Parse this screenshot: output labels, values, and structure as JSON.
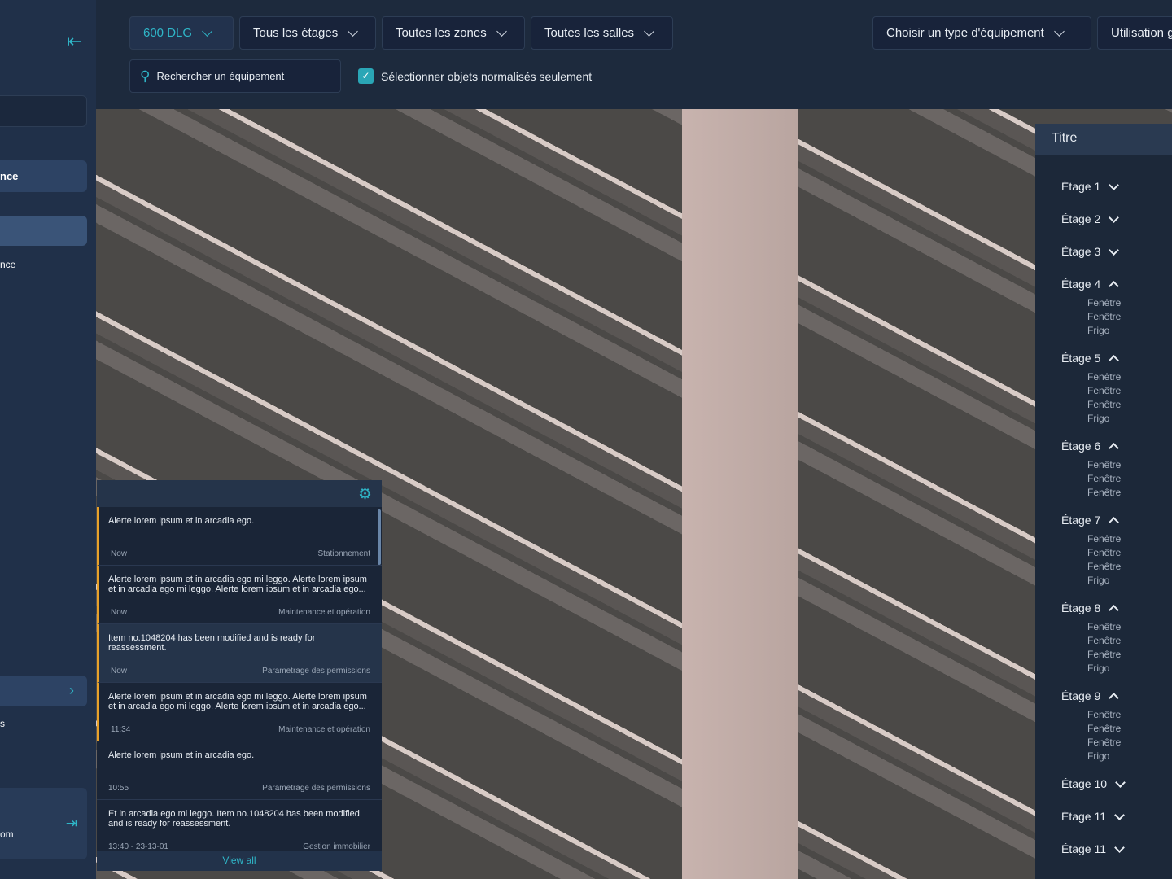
{
  "sidebar": {
    "item_active": "nce",
    "item_2": "nce",
    "item_3": "s",
    "user_email_fragment": "om"
  },
  "topbar": {
    "building": "600 DLG",
    "floors": "Tous les étages",
    "zones": "Toutes les zones",
    "rooms": "Toutes les salles",
    "equipment_type": "Choisir un type d'équipement",
    "usage": "Utilisation g",
    "search_placeholder": "Rechercher un équipement",
    "normalized_only_label": "Sélectionner objets normalisés seulement",
    "normalized_only_checked": true
  },
  "right_panel": {
    "title": "Titre",
    "floors": [
      {
        "label": "Étage 1",
        "expanded": false,
        "items": []
      },
      {
        "label": "Étage 2",
        "expanded": false,
        "items": []
      },
      {
        "label": "Étage 3",
        "expanded": false,
        "items": []
      },
      {
        "label": "Étage 4",
        "expanded": true,
        "items": [
          "Fenêtre",
          "Fenêtre",
          "Frigo"
        ]
      },
      {
        "label": "Étage 5",
        "expanded": true,
        "items": [
          "Fenêtre",
          "Fenêtre",
          "Fenêtre",
          "Frigo"
        ]
      },
      {
        "label": "Étage 6",
        "expanded": true,
        "items": [
          "Fenêtre",
          "Fenêtre",
          "Fenêtre"
        ]
      },
      {
        "label": "Étage 7",
        "expanded": true,
        "items": [
          "Fenêtre",
          "Fenêtre",
          "Fenêtre",
          "Frigo"
        ]
      },
      {
        "label": "Étage 8",
        "expanded": true,
        "items": [
          "Fenêtre",
          "Fenêtre",
          "Fenêtre",
          "Frigo"
        ]
      },
      {
        "label": "Étage 9",
        "expanded": true,
        "items": [
          "Fenêtre",
          "Fenêtre",
          "Fenêtre",
          "Frigo"
        ]
      },
      {
        "label": "Étage 10",
        "expanded": false,
        "items": []
      },
      {
        "label": "Étage 11",
        "expanded": false,
        "items": []
      },
      {
        "label": "Étage 11",
        "expanded": false,
        "items": []
      }
    ]
  },
  "notifications": {
    "view_all": "View all",
    "items": [
      {
        "message": "Alerte lorem ipsum et in arcadia ego.",
        "time": "Now",
        "category": "Stationnement",
        "unread": true,
        "highlight": false
      },
      {
        "message": "Alerte lorem ipsum et in arcadia ego mi leggo. Alerte lorem ipsum et in arcadia ego mi leggo. Alerte lorem ipsum et in arcadia ego...",
        "time": "Now",
        "category": "Maintenance et opération",
        "unread": true,
        "highlight": false
      },
      {
        "message": "Item no.1048204 has been modified and is ready for reassessment.",
        "time": "Now",
        "category": "Parametrage des permissions",
        "unread": true,
        "highlight": true
      },
      {
        "message": "Alerte lorem ipsum et in arcadia ego mi leggo. Alerte lorem ipsum et in arcadia ego mi leggo. Alerte lorem ipsum et in arcadia ego...",
        "time": "11:34",
        "category": "Maintenance et opération",
        "unread": true,
        "highlight": false
      },
      {
        "message": "Alerte lorem ipsum et in arcadia ego.",
        "time": "10:55",
        "category": "Parametrage des permissions",
        "unread": false,
        "highlight": false
      },
      {
        "message": "Et in arcadia ego mi leggo. Item no.1048204 has been modified and is ready for reassessment.",
        "time": "13:40 - 23-13-01",
        "category": "Gestion immobilier",
        "unread": false,
        "highlight": false
      }
    ]
  }
}
